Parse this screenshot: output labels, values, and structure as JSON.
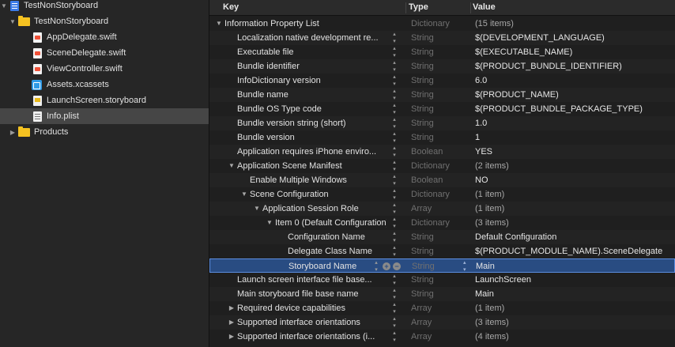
{
  "navigator": {
    "items": [
      {
        "label": "TestNonStoryboard",
        "icon": "project-file-icon",
        "disclosure": "▼"
      },
      {
        "label": "TestNonStoryboard",
        "icon": "folder-icon",
        "disclosure": "▼"
      },
      {
        "label": "AppDelegate.swift",
        "icon": "swift-file-icon"
      },
      {
        "label": "SceneDelegate.swift",
        "icon": "swift-file-icon"
      },
      {
        "label": "ViewController.swift",
        "icon": "swift-file-icon"
      },
      {
        "label": "Assets.xcassets",
        "icon": "asset-catalog-icon"
      },
      {
        "label": "LaunchScreen.storyboard",
        "icon": "storyboard-file-icon"
      },
      {
        "label": "Info.plist",
        "icon": "plist-file-icon"
      },
      {
        "label": "Products",
        "icon": "folder-icon",
        "disclosure": "▶"
      }
    ],
    "selected": "Info.plist"
  },
  "plist": {
    "columns": {
      "key": "Key",
      "type": "Type",
      "value": "Value"
    },
    "rows": [
      {
        "key": "Information Property List",
        "type": "Dictionary",
        "value": "(15 items)",
        "disclosure": "▼"
      },
      {
        "key": "Localization native development re...",
        "type": "String",
        "value": "$(DEVELOPMENT_LANGUAGE)"
      },
      {
        "key": "Executable file",
        "type": "String",
        "value": "$(EXECUTABLE_NAME)"
      },
      {
        "key": "Bundle identifier",
        "type": "String",
        "value": "$(PRODUCT_BUNDLE_IDENTIFIER)"
      },
      {
        "key": "InfoDictionary version",
        "type": "String",
        "value": "6.0"
      },
      {
        "key": "Bundle name",
        "type": "String",
        "value": "$(PRODUCT_NAME)"
      },
      {
        "key": "Bundle OS Type code",
        "type": "String",
        "value": "$(PRODUCT_BUNDLE_PACKAGE_TYPE)"
      },
      {
        "key": "Bundle version string (short)",
        "type": "String",
        "value": "1.0"
      },
      {
        "key": "Bundle version",
        "type": "String",
        "value": "1"
      },
      {
        "key": "Application requires iPhone enviro...",
        "type": "Boolean",
        "value": "YES"
      },
      {
        "key": "Application Scene Manifest",
        "type": "Dictionary",
        "value": "(2 items)",
        "disclosure": "▼"
      },
      {
        "key": "Enable Multiple Windows",
        "type": "Boolean",
        "value": "NO"
      },
      {
        "key": "Scene Configuration",
        "type": "Dictionary",
        "value": "(1 item)",
        "disclosure": "▼"
      },
      {
        "key": "Application Session Role",
        "type": "Array",
        "value": "(1 item)",
        "disclosure": "▼"
      },
      {
        "key": "Item 0 (Default Configuration)",
        "type": "Dictionary",
        "value": "(3 items)",
        "disclosure": "▼"
      },
      {
        "key": "Configuration Name",
        "type": "String",
        "value": "Default Configuration"
      },
      {
        "key": "Delegate Class Name",
        "type": "String",
        "value": "$(PRODUCT_MODULE_NAME).SceneDelegate"
      },
      {
        "key": "Storyboard Name",
        "type": "String",
        "value": "Main"
      },
      {
        "key": "Launch screen interface file base...",
        "type": "String",
        "value": "LaunchScreen"
      },
      {
        "key": "Main storyboard file base name",
        "type": "String",
        "value": "Main"
      },
      {
        "key": "Required device capabilities",
        "type": "Array",
        "value": "(1 item)",
        "disclosure": "▶"
      },
      {
        "key": "Supported interface orientations",
        "type": "Array",
        "value": "(3 items)",
        "disclosure": "▶"
      },
      {
        "key": "Supported interface orientations (i...",
        "type": "Array",
        "value": "(4 items)",
        "disclosure": "▶"
      }
    ],
    "selected_key": "Storyboard Name"
  }
}
